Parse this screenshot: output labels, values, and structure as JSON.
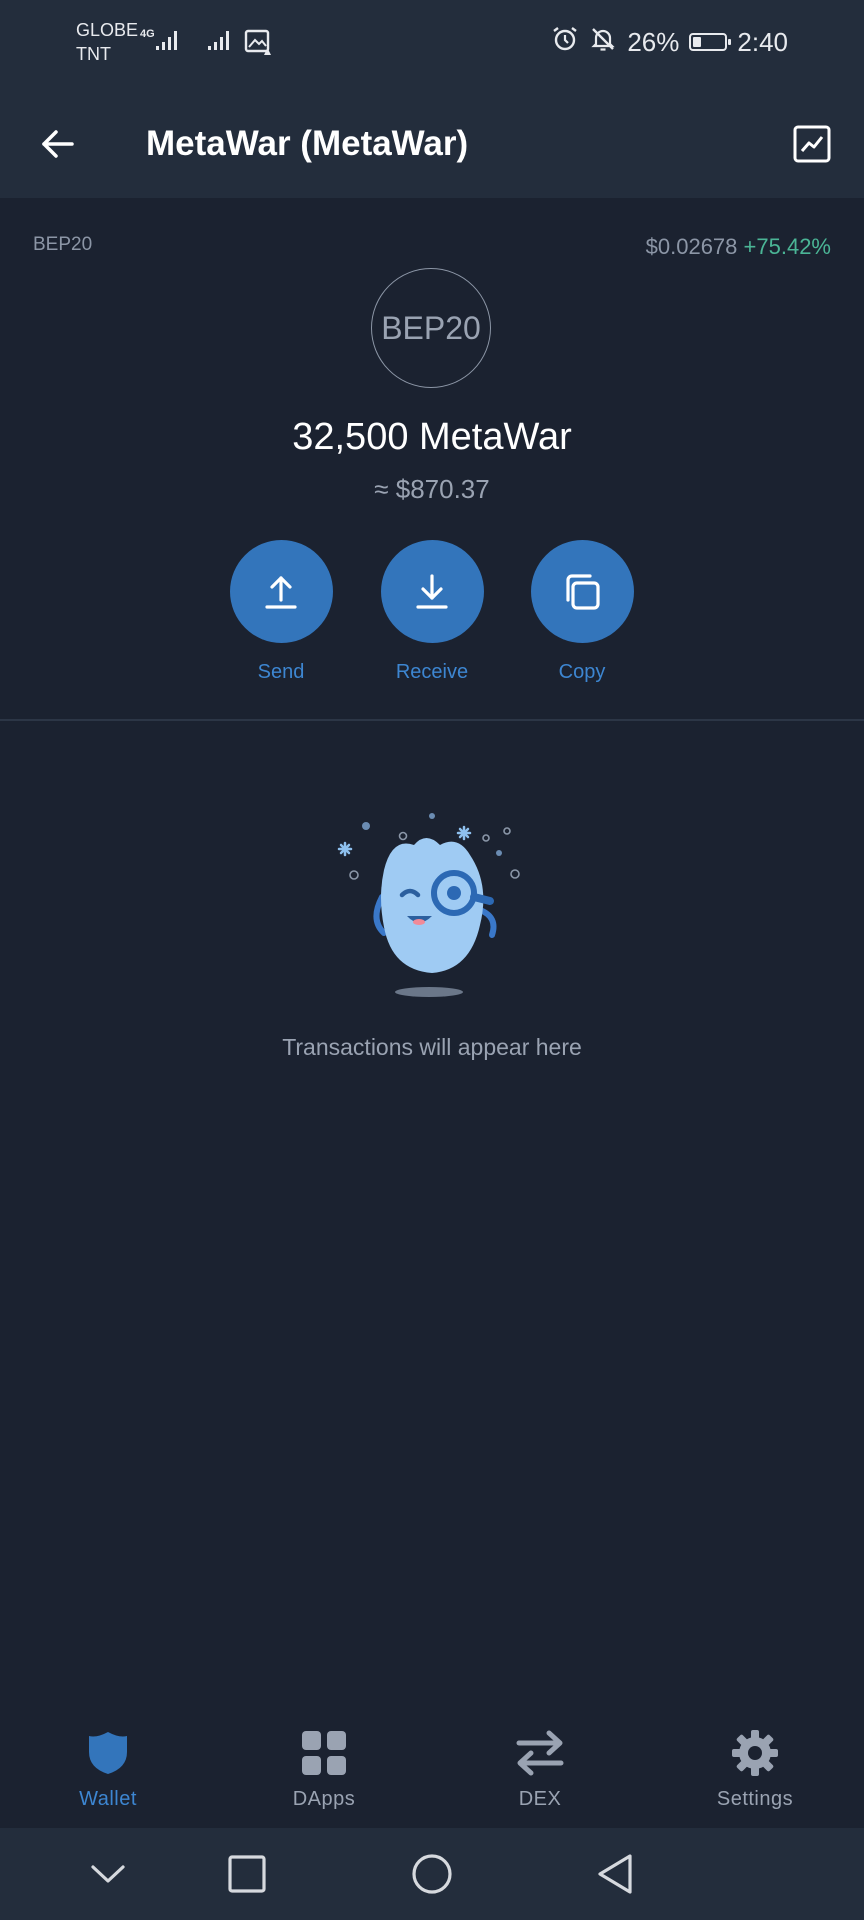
{
  "status_bar": {
    "carrier_1": "GLOBE",
    "carrier_2": "TNT",
    "network_type": "4G",
    "battery_percent": "26%",
    "battery_level": 0.26,
    "time": "2:40",
    "icons": [
      "signal-icon",
      "signal-icon",
      "photo-alert-icon",
      "alarm-icon",
      "bell-off-icon",
      "battery-icon"
    ]
  },
  "app_bar": {
    "back_icon": "arrow-left-icon",
    "title": "MetaWar (MetaWar)",
    "chart_icon": "chart-line-icon"
  },
  "token": {
    "network": "BEP20",
    "price": "$0.02678",
    "price_change": "+75.42%",
    "logo_text": "BEP20",
    "balance": "32,500 MetaWar",
    "fiat_balance": "≈ $870.37"
  },
  "actions": [
    {
      "label": "Send",
      "icon": "arrow-up-icon"
    },
    {
      "label": "Receive",
      "icon": "arrow-down-icon"
    },
    {
      "label": "Copy",
      "icon": "copy-icon"
    }
  ],
  "empty_state": {
    "message": "Transactions will appear here"
  },
  "bottom_nav": [
    {
      "label": "Wallet",
      "icon": "shield-icon",
      "active": true
    },
    {
      "label": "DApps",
      "icon": "grid-icon",
      "active": false
    },
    {
      "label": "DEX",
      "icon": "swap-icon",
      "active": false
    },
    {
      "label": "Settings",
      "icon": "gear-icon",
      "active": false
    }
  ],
  "system_nav": [
    "chevron-down-icon",
    "recents-icon",
    "home-icon",
    "back-triangle-icon"
  ],
  "colors": {
    "background": "#1b2230",
    "header": "#232d3c",
    "accent": "#3375bb",
    "accent_text": "#3d86d1",
    "positive": "#4bb596",
    "muted": "#9aa3b2"
  }
}
